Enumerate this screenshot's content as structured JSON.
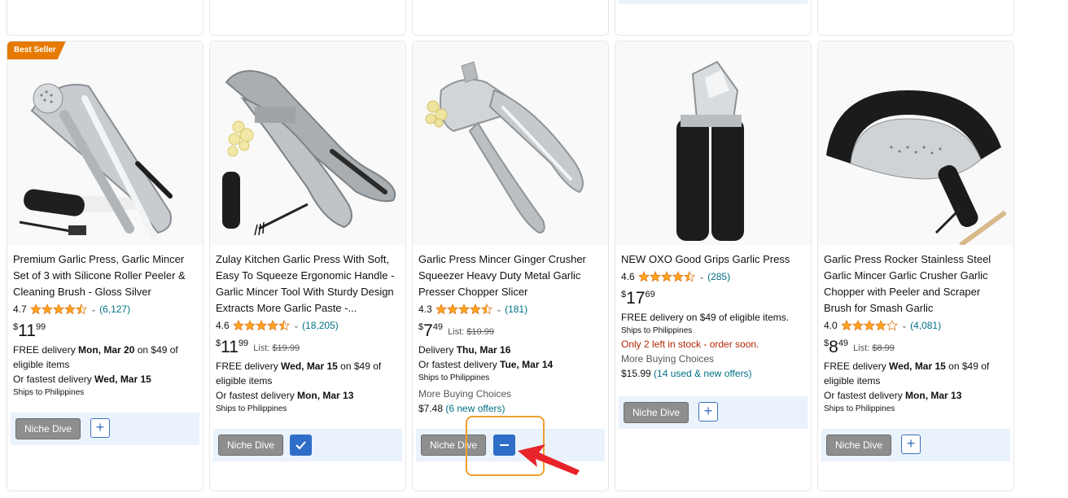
{
  "products": [
    {
      "badge": "Best Seller",
      "title": "Premium Garlic Press, Garlic Mincer Set of 3 with Silicone Roller Peeler & Cleaning Brush - Gloss Silver",
      "rating": "4.7",
      "stars": 4.5,
      "reviews": "(6,127)",
      "price": {
        "symbol": "$",
        "whole": "11",
        "fraction": "99"
      },
      "lines": [
        {
          "pre": "FREE delivery ",
          "bold": "Mon, Mar 20",
          "post": " on $49 of eligible items"
        },
        {
          "pre": "Or fastest delivery ",
          "bold": "Wed, Mar 15",
          "post": ""
        }
      ],
      "ships": "Ships to Philippines",
      "button": "Niche Dive",
      "action": "plus"
    },
    {
      "title": "Zulay Kitchen Garlic Press With Soft, Easy To Squeeze Ergonomic Handle - Garlic Mincer Tool With Sturdy Design Extracts More Garlic Paste -...",
      "rating": "4.6",
      "stars": 4.5,
      "reviews": "(18,205)",
      "price": {
        "symbol": "$",
        "whole": "11",
        "fraction": "99"
      },
      "list_label": "List:",
      "list_price": "$19.99",
      "lines": [
        {
          "pre": "FREE delivery ",
          "bold": "Wed, Mar 15",
          "post": " on $49 of eligible items"
        },
        {
          "pre": "Or fastest delivery ",
          "bold": "Mon, Mar 13",
          "post": ""
        }
      ],
      "ships": "Ships to Philippines",
      "button": "Niche Dive",
      "action": "check"
    },
    {
      "title": "Garlic Press Mincer Ginger Crusher Squeezer Heavy Duty Metal Garlic Presser Chopper Slicer",
      "rating": "4.3",
      "stars": 4.5,
      "reviews": "(181)",
      "price": {
        "symbol": "$",
        "whole": "7",
        "fraction": "49"
      },
      "list_label": "List:",
      "list_price": "$10.99",
      "lines": [
        {
          "pre": "Delivery ",
          "bold": "Thu, Mar 16",
          "post": ""
        },
        {
          "pre": "Or fastest delivery ",
          "bold": "Tue, Mar 14",
          "post": ""
        }
      ],
      "ships": "Ships to Philippines",
      "more_buying": "More Buying Choices",
      "more_price": "$7.48",
      "more_offers": "(6 new offers)",
      "button": "Niche Dive",
      "action": "minus"
    },
    {
      "title": "NEW OXO Good Grips Garlic Press",
      "rating": "4.6",
      "stars": 4.5,
      "reviews": "(285)",
      "price": {
        "symbol": "$",
        "whole": "17",
        "fraction": "69"
      },
      "lines": [
        {
          "pre": "FREE delivery on $49 of eligible items.",
          "bold": "",
          "post": ""
        }
      ],
      "ships": "Ships to Philippines",
      "stock": "Only 2 left in stock - order soon.",
      "more_buying": "More Buying Choices",
      "more_price": "$15.99",
      "more_offers": "(14 used & new offers)",
      "button": "Niche Dive",
      "action": "plus"
    },
    {
      "title": "Garlic Press Rocker Stainless Steel Garlic Mincer Garlic Crusher Garlic Chopper with Peeler and Scraper Brush for Smash Garlic",
      "rating": "4.0",
      "stars": 4,
      "reviews": "(4,081)",
      "price": {
        "symbol": "$",
        "whole": "8",
        "fraction": "49"
      },
      "list_label": "List:",
      "list_price": "$8.99",
      "lines": [
        {
          "pre": "FREE delivery ",
          "bold": "Wed, Mar 15",
          "post": " on $49 of eligible items"
        },
        {
          "pre": "Or fastest delivery ",
          "bold": "Mon, Mar 13",
          "post": ""
        }
      ],
      "ships": "Ships to Philippines",
      "button": "Niche Dive",
      "action": "plus"
    }
  ],
  "colors": {
    "star": "#ffa41c",
    "link": "#007185",
    "accent": "#2e6ec8",
    "highlight": "#f0a030",
    "arrow": "#e8232a",
    "badge": "#e67a00"
  }
}
